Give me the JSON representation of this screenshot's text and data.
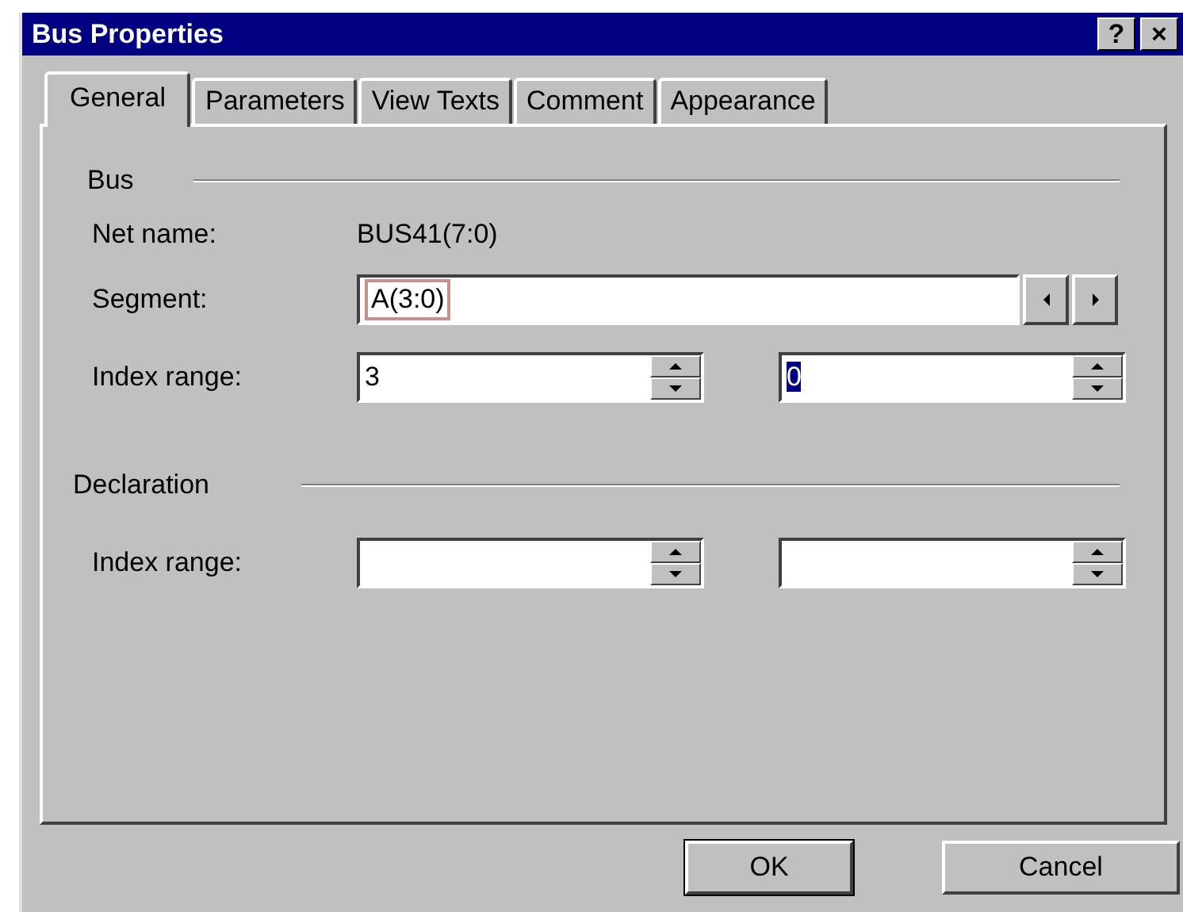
{
  "window": {
    "title": "Bus Properties",
    "title_buttons": [
      "?",
      "×"
    ]
  },
  "tabs": [
    {
      "label": "General",
      "selected": true
    },
    {
      "label": "Parameters",
      "selected": false
    },
    {
      "label": "View Texts",
      "selected": false
    },
    {
      "label": "Comment",
      "selected": false
    },
    {
      "label": "Appearance",
      "selected": false
    }
  ],
  "bus": {
    "heading": "Bus",
    "net_name": {
      "label": "Net name:",
      "value": "BUS41(7:0)"
    },
    "segment": {
      "label": "Segment:",
      "value": "A(3:0)"
    },
    "index_range": {
      "label": "Index range:",
      "from": {
        "value": "3",
        "selected": false
      },
      "to": {
        "value": "0",
        "selected": true
      }
    }
  },
  "declaration": {
    "heading": "Declaration",
    "index_range": {
      "label": "Index range:"
    }
  },
  "buttons": [
    {
      "label": "OK",
      "default": true
    },
    {
      "label": "Cancel",
      "default": false
    }
  ]
}
